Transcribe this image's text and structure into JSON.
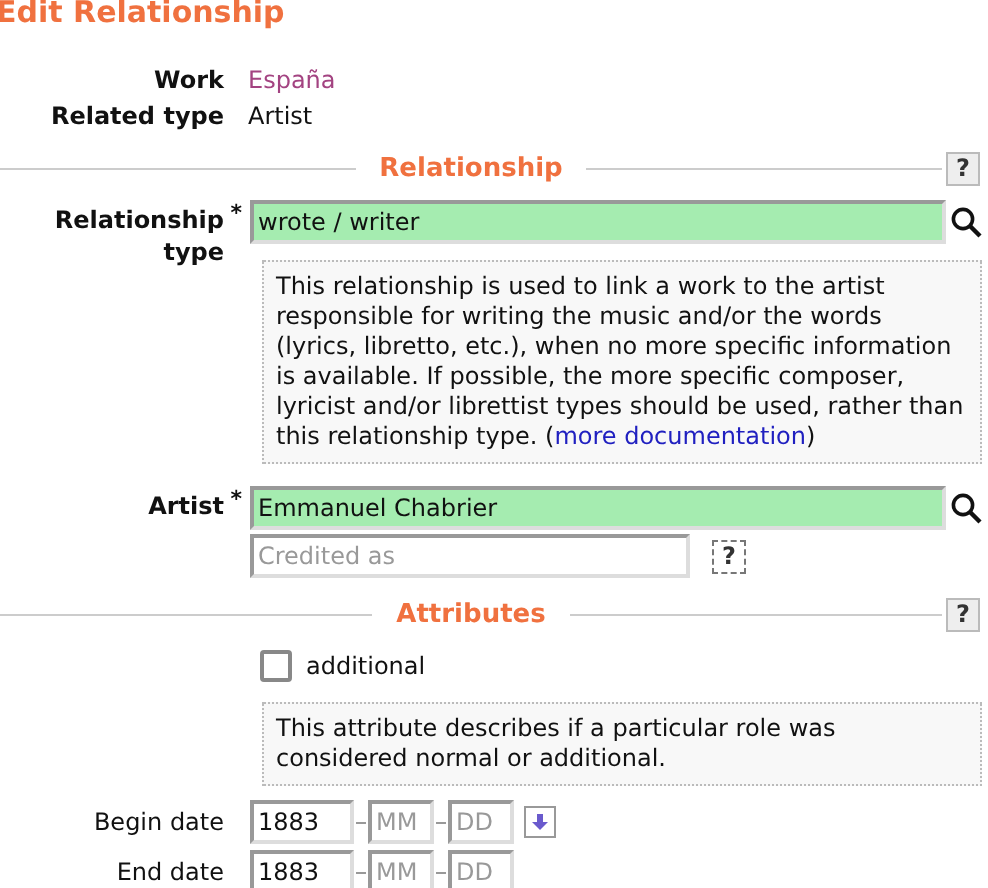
{
  "title": "Edit Relationship",
  "info": [
    {
      "label": "Work",
      "value": "España",
      "kind": "link"
    },
    {
      "label": "Related type",
      "value": "Artist",
      "kind": "text"
    }
  ],
  "relationship": {
    "heading": "Relationship",
    "help_button": "?",
    "type_field": {
      "label": "Relationship type",
      "required_mark": "*",
      "value": "wrote / writer"
    },
    "description": "This relationship is used to link a work to the artist responsible for writing the music and/or the words (lyrics, libretto, etc.), when no more specific information is available. If possible, the more specific composer, lyricist and/or librettist types should be used, rather than this relationship type. (",
    "doc_link": "more documentation",
    "description_end": ")",
    "artist_field": {
      "label": "Artist",
      "required_mark": "*",
      "value": "Emmanuel Chabrier"
    },
    "credited_as": {
      "placeholder": "Credited as"
    },
    "credited_help": "?"
  },
  "attributes": {
    "heading": "Attributes",
    "help_button": "?",
    "checkbox": {
      "label": "additional",
      "checked": false
    },
    "description": "This attribute describes if a particular role was considered normal or additional."
  },
  "dates": [
    {
      "label": "Begin date",
      "year": "1883",
      "month_placeholder": "MM",
      "day_placeholder": "DD",
      "copy_button": true
    },
    {
      "label": "End date",
      "year": "1883",
      "month_placeholder": "MM",
      "day_placeholder": "DD",
      "copy_button": false
    }
  ]
}
